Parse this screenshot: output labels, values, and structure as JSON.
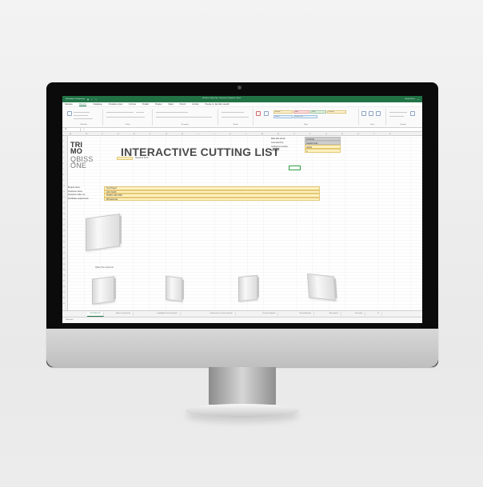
{
  "excel": {
    "title_left": "Samodejno shranjevanje",
    "window_title": "IntCutList - Qbiss One - Interactive Cutting List - Excel",
    "title_right": "Gorazd Kvas",
    "menu": [
      "Datoteka",
      "Osnovno",
      "Vstavljanje",
      "Postavitev strani",
      "Formule",
      "Podatki",
      "Pregled",
      "Ogled",
      "Pomoč",
      "Acrobat",
      "Povejte mi, kaj želite narediti"
    ],
    "ribbon_labels": [
      "Odložišče",
      "Pisava",
      "Poravnava",
      "Število",
      "Slogi",
      "Celice",
      "Urejanje"
    ],
    "style_boxes": [
      "Navadno",
      "Slabo",
      "Dobro",
      "Nevtralno",
      "Izračun",
      "Preveri celico"
    ],
    "name_box": "N7",
    "fx": "fx",
    "columns": [
      "A",
      "B",
      "C",
      "D",
      "E",
      "F",
      "G",
      "H",
      "I",
      "J",
      "K",
      "L",
      "M",
      "N",
      "O",
      "P",
      "Q",
      "R",
      "S",
      "T",
      "U"
    ],
    "rows": [
      "1",
      "2",
      "3",
      "4",
      "5",
      "6",
      "7",
      "8",
      "9",
      "10",
      "11",
      "12",
      "13",
      "14",
      "15",
      "16",
      "17",
      "18",
      "19",
      "20",
      "21",
      "22",
      "23",
      "24",
      "25",
      "26",
      "27",
      "28",
      "29",
      "30",
      "31"
    ]
  },
  "document": {
    "logo": {
      "line1": "TRI",
      "line2": "MO",
      "line3": "QBISS",
      "line4": "ONE"
    },
    "title": "INTERACTIVE CUTTING LIST",
    "required_fields": "Required fields",
    "small_note": "In case order",
    "meta": [
      {
        "label": "Date last saved:",
        "value": "23-09-20"
      },
      {
        "label": "Last saved by:",
        "value": "Gorazd Kvas"
      },
      {
        "label": "Cutting list number:",
        "value": "A0001"
      },
      {
        "label": "Revision:",
        "value": "0"
      }
    ],
    "project": [
      {
        "label": "Project name:",
        "value": "Test Project"
      },
      {
        "label": "Customer name:",
        "value": "John Smith"
      },
      {
        "label": "Customer order no.:",
        "value": "POR01 1001 BET"
      },
      {
        "label": "Certificate requirement:",
        "value": "FM approval"
      }
    ],
    "qbiss_one_elements": "Qbiss One elements:"
  },
  "sheet_tabs": [
    "CUTTING LIST",
    "Qbiss One elements",
    "Longitudinal corner elements",
    "Transverse & L-corner elements",
    "U-corner elements",
    "Curved elements",
    "Accessories",
    "Instruction"
  ],
  "status": "Pripravljen",
  "colors": {
    "excel_green": "#217346",
    "required_fill": "#fff1bf",
    "gray_fill": "#cfcfcf",
    "selection_green": "#2f9e44"
  }
}
